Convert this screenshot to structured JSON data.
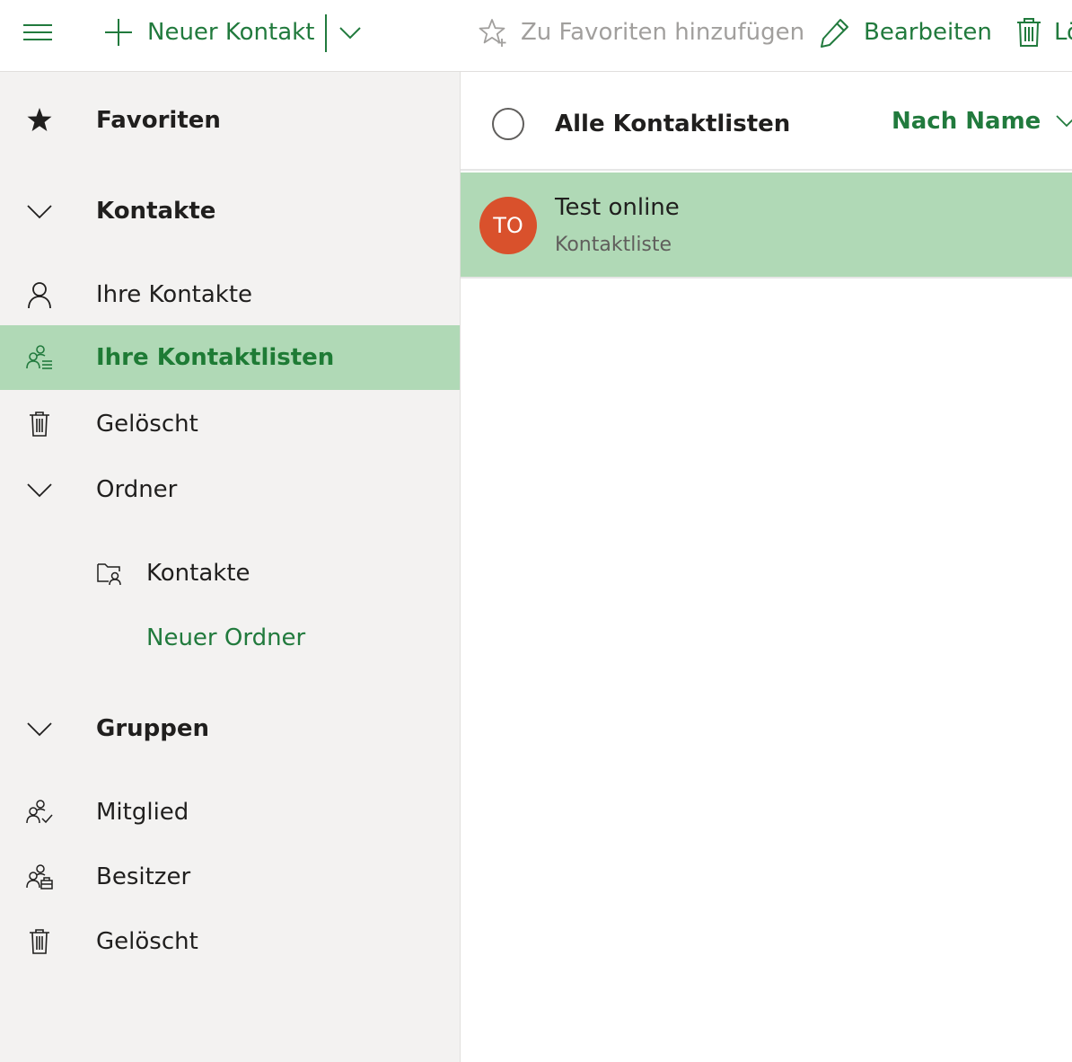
{
  "toolbar": {
    "new_contact_label": "Neuer Kontakt",
    "add_favorites_label": "Zu Favoriten hinzufügen",
    "edit_label": "Bearbeiten",
    "delete_label": "Lö"
  },
  "sidebar": {
    "favorites_label": "Favoriten",
    "contacts_section_label": "Kontakte",
    "your_contacts_label": "Ihre Kontakte",
    "your_contact_lists_label": "Ihre Kontaktlisten",
    "deleted_label": "Gelöscht",
    "folders_label": "Ordner",
    "folder_contacts_label": "Kontakte",
    "new_folder_label": "Neuer Ordner",
    "groups_label": "Gruppen",
    "member_label": "Mitglied",
    "owner_label": "Besitzer",
    "groups_deleted_label": "Gelöscht"
  },
  "list": {
    "select_all_label": "Alle Kontaktlisten",
    "sort_label": "Nach Name",
    "items": [
      {
        "initials": "TO",
        "name": "Test online",
        "subtitle": "Kontaktliste"
      }
    ]
  },
  "colors": {
    "accent": "#217a3d",
    "selected_bg": "#b0d9b6",
    "sidebar_bg": "#f3f2f1",
    "avatar_bg": "#d9512c"
  }
}
